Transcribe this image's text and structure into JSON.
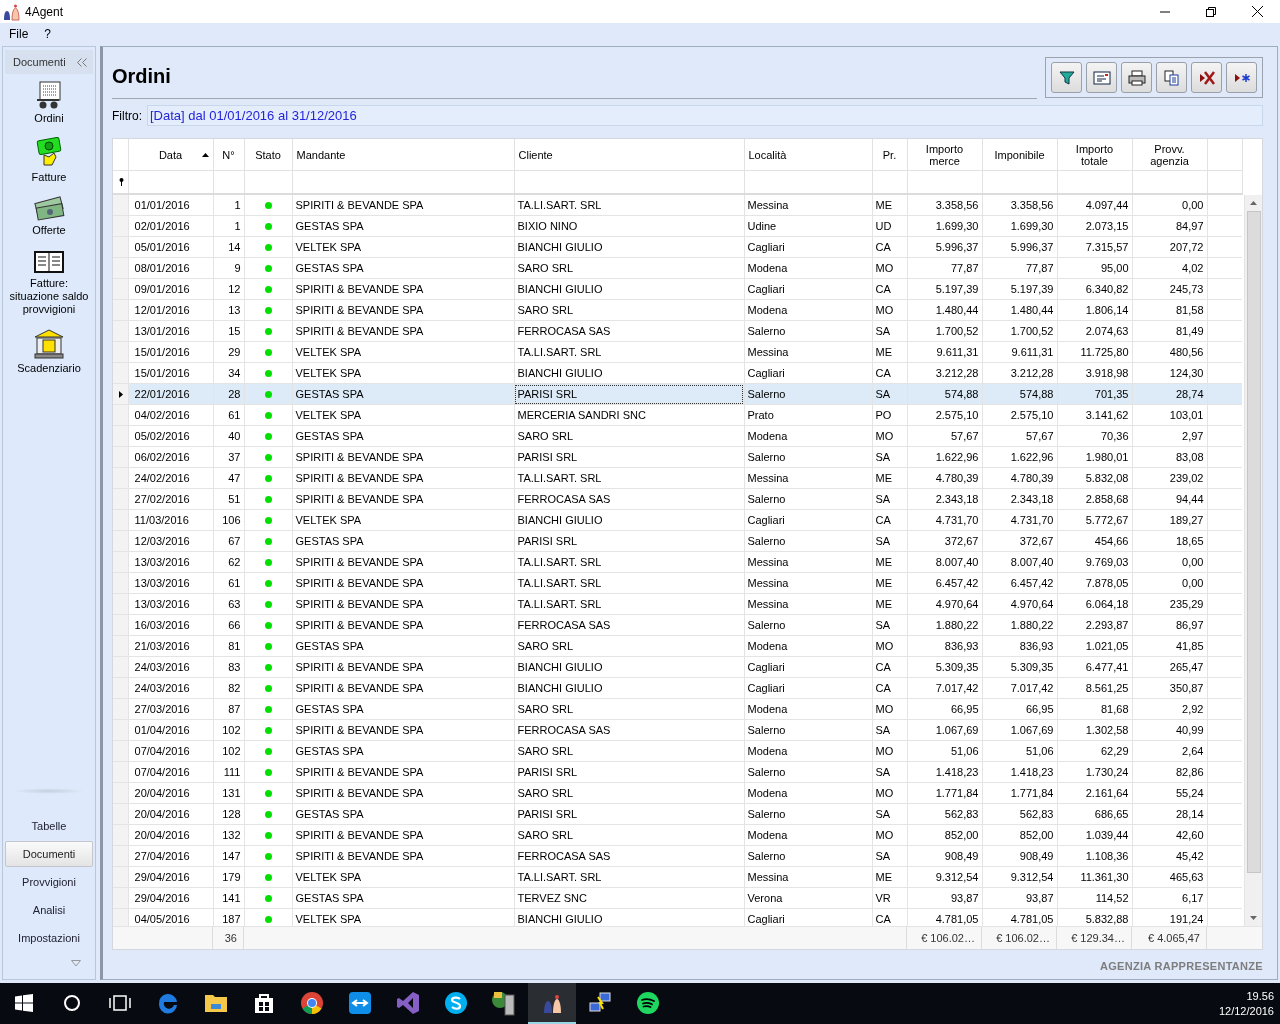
{
  "window": {
    "title": "4Agent"
  },
  "menu": [
    "File",
    "?"
  ],
  "sidebar": {
    "header": "Documenti",
    "items": [
      {
        "label": "Ordini",
        "kind": "orders"
      },
      {
        "label": "Fatture",
        "kind": "invoices"
      },
      {
        "label": "Offerte",
        "kind": "offers"
      },
      {
        "label": "Fatture: situazione saldo provvigioni",
        "kind": "book"
      },
      {
        "label": "Scadenziario",
        "kind": "bank"
      }
    ],
    "sections": [
      {
        "label": "Tabelle",
        "selected": false
      },
      {
        "label": "Documenti",
        "selected": true
      },
      {
        "label": "Provvigioni",
        "selected": false
      },
      {
        "label": "Analisi",
        "selected": false
      },
      {
        "label": "Impostazioni",
        "selected": false
      }
    ]
  },
  "page": {
    "title": "Ordini",
    "toolbar": [
      {
        "kind": "filter"
      },
      {
        "kind": "card"
      },
      {
        "kind": "print"
      },
      {
        "kind": "copy"
      },
      {
        "kind": "delete"
      },
      {
        "kind": "new"
      }
    ],
    "filter": {
      "label": "Filtro:",
      "value": "[Data] dal 01/01/2016 al 31/12/2016"
    }
  },
  "table": {
    "columns": [
      {
        "label": "Data",
        "sorted": true
      },
      {
        "label": "N°",
        "sorted": false
      },
      {
        "label": "Stato",
        "sorted": false
      },
      {
        "label": "Mandante",
        "sorted": false
      },
      {
        "label": "Cliente",
        "sorted": false
      },
      {
        "label": "Località",
        "sorted": false
      },
      {
        "label": "Pr.",
        "sorted": false
      },
      {
        "label": "Importo merce",
        "sorted": false
      },
      {
        "label": "Imponibile",
        "sorted": false
      },
      {
        "label": "Importo totale",
        "sorted": false
      },
      {
        "label": "Provv. agenzia",
        "sorted": false
      }
    ],
    "rows": [
      {
        "cells": [
          "01/01/2016",
          "1",
          "",
          "SPIRITI & BEVANDE SPA",
          "TA.LI.SART. SRL",
          "Messina",
          "ME",
          "3.358,56",
          "3.358,56",
          "4.097,44",
          "0,00"
        ],
        "color": "#00e000",
        "selected": false
      },
      {
        "cells": [
          "02/01/2016",
          "1",
          "",
          "GESTAS SPA",
          "BIXIO NINO",
          "Udine",
          "UD",
          "1.699,30",
          "1.699,30",
          "2.073,15",
          "84,97"
        ],
        "color": "#00e000",
        "selected": false
      },
      {
        "cells": [
          "05/01/2016",
          "14",
          "",
          "VELTEK SPA",
          "BIANCHI GIULIO",
          "Cagliari",
          "CA",
          "5.996,37",
          "5.996,37",
          "7.315,57",
          "207,72"
        ],
        "color": "#00e000",
        "selected": false
      },
      {
        "cells": [
          "08/01/2016",
          "9",
          "",
          "GESTAS SPA",
          "SARO SRL",
          "Modena",
          "MO",
          "77,87",
          "77,87",
          "95,00",
          "4,02"
        ],
        "color": "#00e000",
        "selected": false
      },
      {
        "cells": [
          "09/01/2016",
          "12",
          "",
          "SPIRITI & BEVANDE SPA",
          "BIANCHI GIULIO",
          "Cagliari",
          "CA",
          "5.197,39",
          "5.197,39",
          "6.340,82",
          "245,73"
        ],
        "color": "#00e000",
        "selected": false
      },
      {
        "cells": [
          "12/01/2016",
          "13",
          "",
          "SPIRITI & BEVANDE SPA",
          "SARO SRL",
          "Modena",
          "MO",
          "1.480,44",
          "1.480,44",
          "1.806,14",
          "81,58"
        ],
        "color": "#00e000",
        "selected": false
      },
      {
        "cells": [
          "13/01/2016",
          "15",
          "",
          "SPIRITI & BEVANDE SPA",
          "FERROCASA SAS",
          "Salerno",
          "SA",
          "1.700,52",
          "1.700,52",
          "2.074,63",
          "81,49"
        ],
        "color": "#00e000",
        "selected": false
      },
      {
        "cells": [
          "15/01/2016",
          "29",
          "",
          "VELTEK SPA",
          "TA.LI.SART. SRL",
          "Messina",
          "ME",
          "9.611,31",
          "9.611,31",
          "11.725,80",
          "480,56"
        ],
        "color": "#00e000",
        "selected": false
      },
      {
        "cells": [
          "15/01/2016",
          "34",
          "",
          "VELTEK SPA",
          "BIANCHI GIULIO",
          "Cagliari",
          "CA",
          "3.212,28",
          "3.212,28",
          "3.918,98",
          "124,30"
        ],
        "color": "#00e000",
        "selected": false
      },
      {
        "cells": [
          "22/01/2016",
          "28",
          "",
          "GESTAS SPA",
          "PARISI SRL",
          "Salerno",
          "SA",
          "574,88",
          "574,88",
          "701,35",
          "28,74"
        ],
        "color": "#00e000",
        "selected": true
      },
      {
        "cells": [
          "04/02/2016",
          "61",
          "",
          "VELTEK SPA",
          "MERCERIA SANDRI SNC",
          "Prato",
          "PO",
          "2.575,10",
          "2.575,10",
          "3.141,62",
          "103,01"
        ],
        "color": "#00e000",
        "selected": false
      },
      {
        "cells": [
          "05/02/2016",
          "40",
          "",
          "GESTAS SPA",
          "SARO SRL",
          "Modena",
          "MO",
          "57,67",
          "57,67",
          "70,36",
          "2,97"
        ],
        "color": "#00e000",
        "selected": false
      },
      {
        "cells": [
          "06/02/2016",
          "37",
          "",
          "SPIRITI & BEVANDE SPA",
          "PARISI SRL",
          "Salerno",
          "SA",
          "1.622,96",
          "1.622,96",
          "1.980,01",
          "83,08"
        ],
        "color": "#00e000",
        "selected": false
      },
      {
        "cells": [
          "24/02/2016",
          "47",
          "",
          "SPIRITI & BEVANDE SPA",
          "TA.LI.SART. SRL",
          "Messina",
          "ME",
          "4.780,39",
          "4.780,39",
          "5.832,08",
          "239,02"
        ],
        "color": "#00e000",
        "selected": false
      },
      {
        "cells": [
          "27/02/2016",
          "51",
          "",
          "SPIRITI & BEVANDE SPA",
          "FERROCASA SAS",
          "Salerno",
          "SA",
          "2.343,18",
          "2.343,18",
          "2.858,68",
          "94,44"
        ],
        "color": "#00e000",
        "selected": false
      },
      {
        "cells": [
          "11/03/2016",
          "106",
          "",
          "VELTEK SPA",
          "BIANCHI GIULIO",
          "Cagliari",
          "CA",
          "4.731,70",
          "4.731,70",
          "5.772,67",
          "189,27"
        ],
        "color": "#00e000",
        "selected": false
      },
      {
        "cells": [
          "12/03/2016",
          "67",
          "",
          "GESTAS SPA",
          "PARISI SRL",
          "Salerno",
          "SA",
          "372,67",
          "372,67",
          "454,66",
          "18,65"
        ],
        "color": "#00e000",
        "selected": false
      },
      {
        "cells": [
          "13/03/2016",
          "62",
          "",
          "SPIRITI & BEVANDE SPA",
          "TA.LI.SART. SRL",
          "Messina",
          "ME",
          "8.007,40",
          "8.007,40",
          "9.769,03",
          "0,00"
        ],
        "color": "#00e000",
        "selected": false
      },
      {
        "cells": [
          "13/03/2016",
          "61",
          "",
          "SPIRITI & BEVANDE SPA",
          "TA.LI.SART. SRL",
          "Messina",
          "ME",
          "6.457,42",
          "6.457,42",
          "7.878,05",
          "0,00"
        ],
        "color": "#00e000",
        "selected": false
      },
      {
        "cells": [
          "13/03/2016",
          "63",
          "",
          "SPIRITI & BEVANDE SPA",
          "TA.LI.SART. SRL",
          "Messina",
          "ME",
          "4.970,64",
          "4.970,64",
          "6.064,18",
          "235,29"
        ],
        "color": "#00e000",
        "selected": false
      },
      {
        "cells": [
          "16/03/2016",
          "66",
          "",
          "SPIRITI & BEVANDE SPA",
          "FERROCASA SAS",
          "Salerno",
          "SA",
          "1.880,22",
          "1.880,22",
          "2.293,87",
          "86,97"
        ],
        "color": "#00e000",
        "selected": false
      },
      {
        "cells": [
          "21/03/2016",
          "81",
          "",
          "GESTAS SPA",
          "SARO SRL",
          "Modena",
          "MO",
          "836,93",
          "836,93",
          "1.021,05",
          "41,85"
        ],
        "color": "#00e000",
        "selected": false
      },
      {
        "cells": [
          "24/03/2016",
          "83",
          "",
          "SPIRITI & BEVANDE SPA",
          "BIANCHI GIULIO",
          "Cagliari",
          "CA",
          "5.309,35",
          "5.309,35",
          "6.477,41",
          "265,47"
        ],
        "color": "#00e000",
        "selected": false
      },
      {
        "cells": [
          "24/03/2016",
          "82",
          "",
          "SPIRITI & BEVANDE SPA",
          "BIANCHI GIULIO",
          "Cagliari",
          "CA",
          "7.017,42",
          "7.017,42",
          "8.561,25",
          "350,87"
        ],
        "color": "#00e000",
        "selected": false
      },
      {
        "cells": [
          "27/03/2016",
          "87",
          "",
          "GESTAS SPA",
          "SARO SRL",
          "Modena",
          "MO",
          "66,95",
          "66,95",
          "81,68",
          "2,92"
        ],
        "color": "#00e000",
        "selected": false
      },
      {
        "cells": [
          "01/04/2016",
          "102",
          "",
          "SPIRITI & BEVANDE SPA",
          "FERROCASA SAS",
          "Salerno",
          "SA",
          "1.067,69",
          "1.067,69",
          "1.302,58",
          "40,99"
        ],
        "color": "#00e000",
        "selected": false
      },
      {
        "cells": [
          "07/04/2016",
          "102",
          "",
          "GESTAS SPA",
          "SARO SRL",
          "Modena",
          "MO",
          "51,06",
          "51,06",
          "62,29",
          "2,64"
        ],
        "color": "#00e000",
        "selected": false
      },
      {
        "cells": [
          "07/04/2016",
          "111",
          "",
          "SPIRITI & BEVANDE SPA",
          "PARISI SRL",
          "Salerno",
          "SA",
          "1.418,23",
          "1.418,23",
          "1.730,24",
          "82,86"
        ],
        "color": "#00e000",
        "selected": false
      },
      {
        "cells": [
          "20/04/2016",
          "131",
          "",
          "SPIRITI & BEVANDE SPA",
          "SARO SRL",
          "Modena",
          "MO",
          "1.771,84",
          "1.771,84",
          "2.161,64",
          "55,24"
        ],
        "color": "#00e000",
        "selected": false
      },
      {
        "cells": [
          "20/04/2016",
          "128",
          "",
          "GESTAS SPA",
          "PARISI SRL",
          "Salerno",
          "SA",
          "562,83",
          "562,83",
          "686,65",
          "28,14"
        ],
        "color": "#00e000",
        "selected": false
      },
      {
        "cells": [
          "20/04/2016",
          "132",
          "",
          "SPIRITI & BEVANDE SPA",
          "SARO SRL",
          "Modena",
          "MO",
          "852,00",
          "852,00",
          "1.039,44",
          "42,60"
        ],
        "color": "#00e000",
        "selected": false
      },
      {
        "cells": [
          "27/04/2016",
          "147",
          "",
          "SPIRITI & BEVANDE SPA",
          "FERROCASA SAS",
          "Salerno",
          "SA",
          "908,49",
          "908,49",
          "1.108,36",
          "45,42"
        ],
        "color": "#00e000",
        "selected": false
      },
      {
        "cells": [
          "29/04/2016",
          "179",
          "",
          "VELTEK SPA",
          "TA.LI.SART. SRL",
          "Messina",
          "ME",
          "9.312,54",
          "9.312,54",
          "11.361,30",
          "465,63"
        ],
        "color": "#00e000",
        "selected": false
      },
      {
        "cells": [
          "29/04/2016",
          "141",
          "",
          "GESTAS SPA",
          "TERVEZ SNC",
          "Verona",
          "VR",
          "93,87",
          "93,87",
          "114,52",
          "6,17"
        ],
        "color": "#00e000",
        "selected": false
      },
      {
        "cells": [
          "04/05/2016",
          "187",
          "",
          "VELTEK SPA",
          "BIANCHI GIULIO",
          "Cagliari",
          "CA",
          "4.781,05",
          "4.781,05",
          "5.832,88",
          "191,24"
        ],
        "color": "#00e000",
        "selected": false
      }
    ],
    "footer": {
      "count": "36",
      "totals": [
        "€ 106.02…",
        "€ 106.02…",
        "€ 129.34…",
        "€ 4.065,47"
      ]
    }
  },
  "brand": "AGENZIA RAPPRESENTANZE",
  "taskbar": {
    "apps": [
      {
        "kind": "edge",
        "selected": false
      },
      {
        "kind": "folder",
        "selected": false
      },
      {
        "kind": "store",
        "selected": false
      },
      {
        "kind": "chrome",
        "selected": false
      },
      {
        "kind": "remote",
        "selected": false
      },
      {
        "kind": "studio",
        "selected": false
      },
      {
        "kind": "skype",
        "selected": false
      },
      {
        "kind": "server",
        "selected": false
      },
      {
        "kind": "agent",
        "selected": true
      },
      {
        "kind": "network",
        "selected": false
      },
      {
        "kind": "spotify",
        "selected": false
      }
    ],
    "time": "19.56",
    "date": "12/12/2016"
  }
}
